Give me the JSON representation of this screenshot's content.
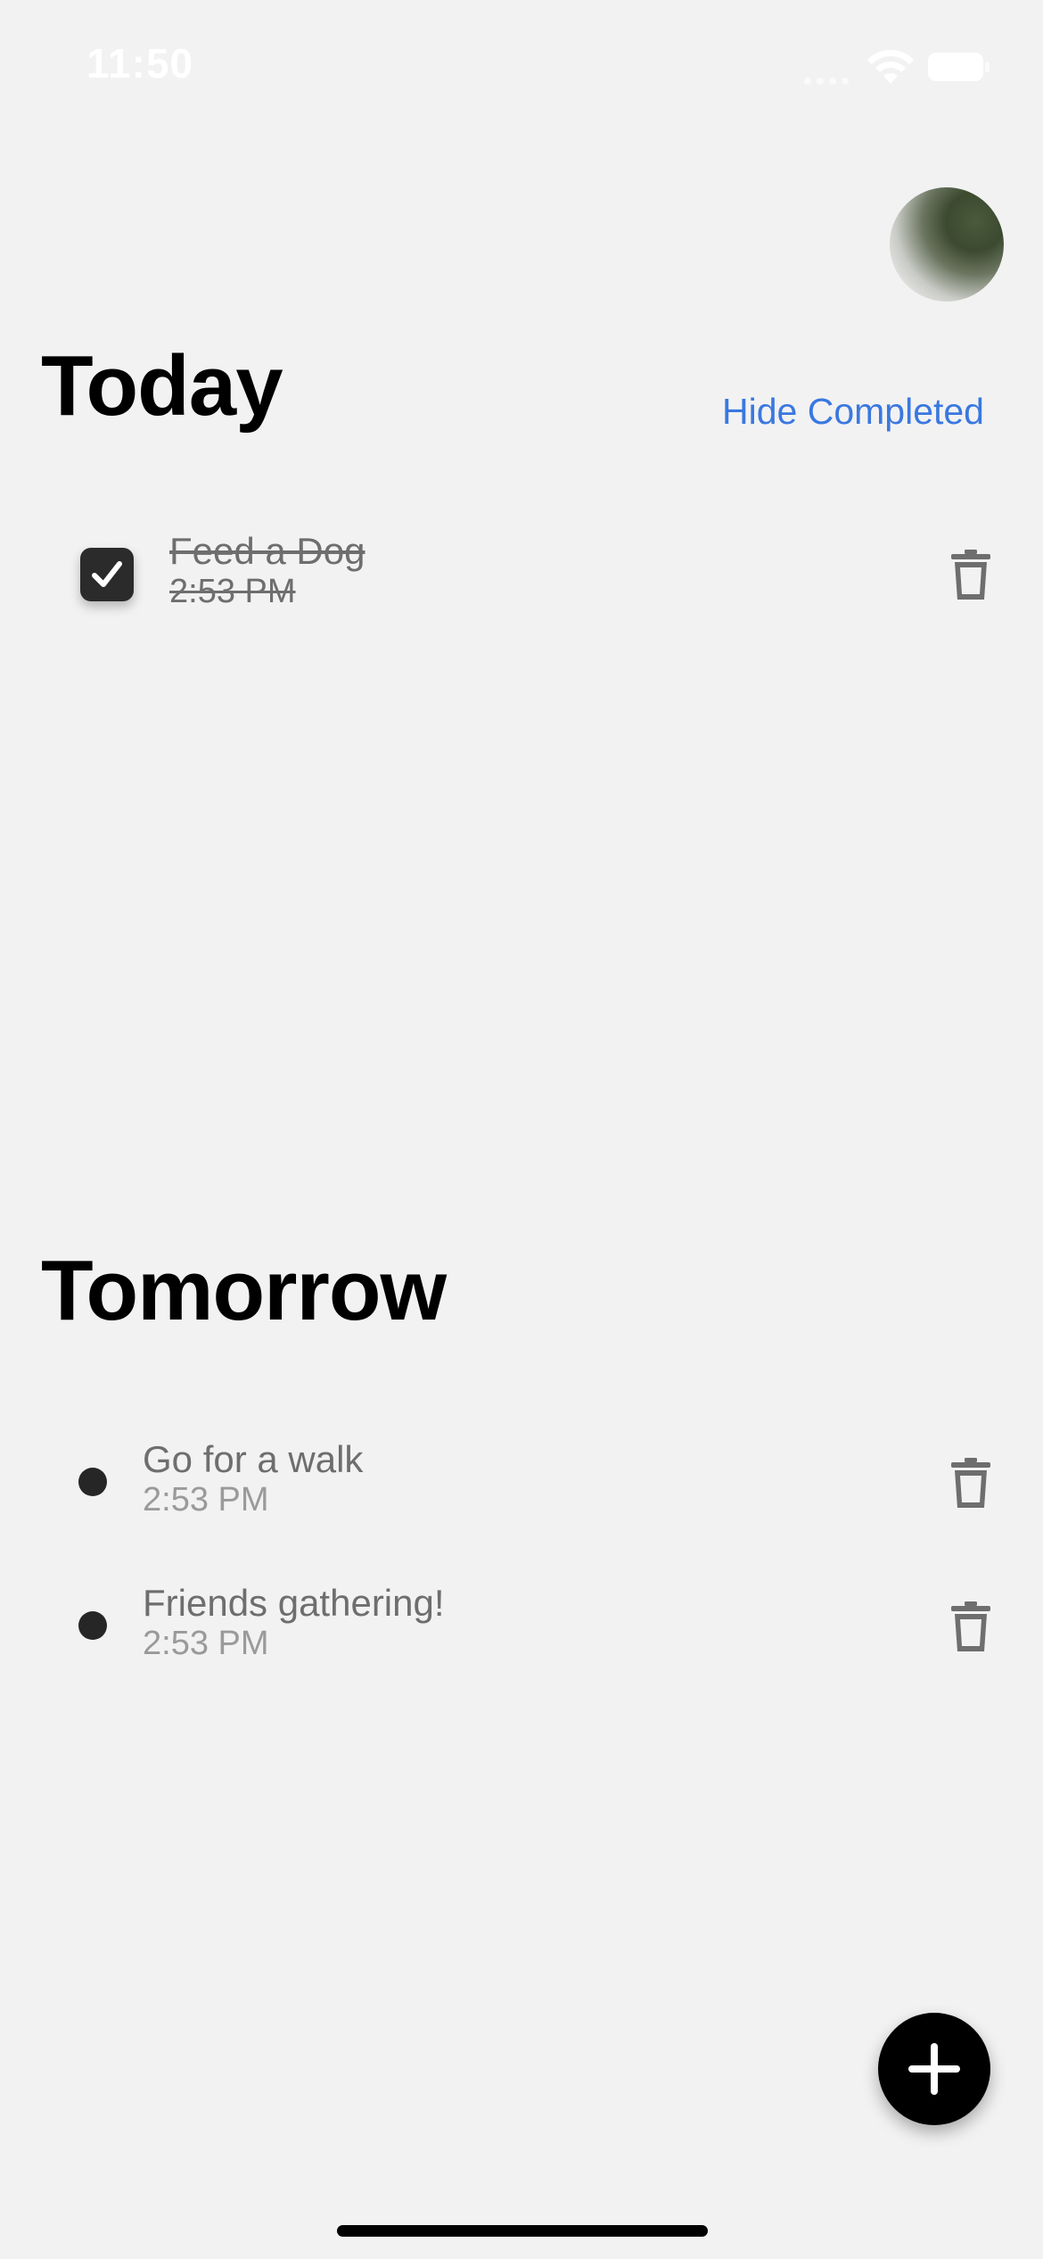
{
  "status_bar": {
    "time": "11:50"
  },
  "header": {
    "avatar_icon": "profile-photo-avatar",
    "hide_completed_label": "Hide Completed"
  },
  "sections": {
    "today": {
      "title": "Today",
      "tasks": [
        {
          "title": "Feed a Dog",
          "time": "2:53 PM",
          "completed": true
        }
      ]
    },
    "tomorrow": {
      "title": "Tomorrow",
      "tasks": [
        {
          "title": "Go for a walk",
          "time": "2:53 PM",
          "completed": false
        },
        {
          "title": "Friends gathering!",
          "time": "2:53 PM",
          "completed": false
        }
      ]
    }
  },
  "icons": {
    "delete": "trash-icon",
    "add": "plus-icon",
    "check": "checkmark-icon"
  },
  "colors": {
    "background": "#f2f2f2",
    "accent": "#3a78e0",
    "fab": "#000000"
  }
}
